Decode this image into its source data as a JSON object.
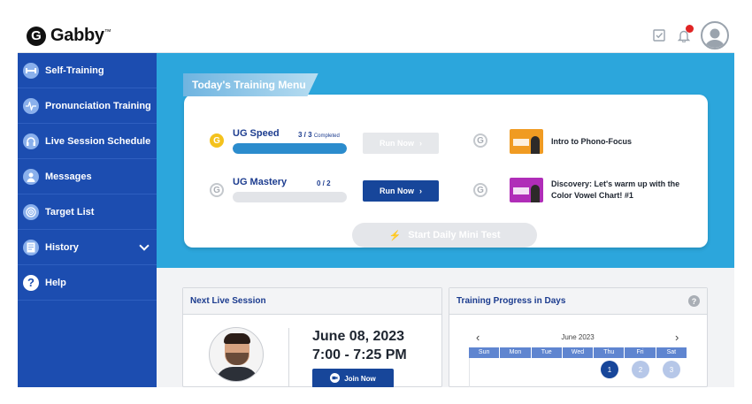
{
  "header": {
    "logo_text": "Gabby",
    "logo_tm": "™",
    "logo_mark": "G",
    "icons": [
      "check-square-icon",
      "bell-icon",
      "user-avatar-icon"
    ]
  },
  "sidebar": {
    "items": [
      {
        "label": "Self-Training",
        "icon": "dumbbell-icon"
      },
      {
        "label": "Pronunciation Training",
        "icon": "waveform-icon"
      },
      {
        "label": "Live Session Schedule",
        "icon": "headset-icon"
      },
      {
        "label": "Messages",
        "icon": "user-icon"
      },
      {
        "label": "Target List",
        "icon": "target-icon"
      },
      {
        "label": "History",
        "icon": "document-icon"
      },
      {
        "label": "Help",
        "icon": "question-icon"
      }
    ]
  },
  "training_menu": {
    "title": "Today's Training Menu",
    "tasks": [
      {
        "name": "UG Speed",
        "progress_text": "3 / 3",
        "completed_label": "Completed",
        "progress_fraction": 1.0,
        "button": "Run Now",
        "state": "completed"
      },
      {
        "name": "UG Mastery",
        "progress_text": "0 / 2",
        "completed_label": "",
        "progress_fraction": 0.0,
        "button": "Run Now",
        "state": "active"
      }
    ],
    "videos": [
      {
        "title": "Intro to Phono-Focus"
      },
      {
        "title": "Discovery: Let's warm up with the Color Vowel Chart! #1"
      }
    ],
    "mini_test_label": "Start Daily Mini Test"
  },
  "next_session": {
    "heading": "Next Live Session",
    "date": "June 08, 2023",
    "time": "7:00 - 7:25 PM",
    "join_label": "Join Now"
  },
  "progress_calendar": {
    "heading": "Training Progress in Days",
    "help_label": "?",
    "month": "June 2023",
    "prev": "‹",
    "next": "›",
    "weekdays": [
      "Sun",
      "Mon",
      "Tue",
      "Wed",
      "Thu",
      "Fri",
      "Sat"
    ],
    "visible_days": [
      {
        "day": "1",
        "status": "done"
      },
      {
        "day": "2",
        "status": "future"
      },
      {
        "day": "3",
        "status": "future"
      }
    ]
  },
  "colors": {
    "brand_blue": "#1c4db0",
    "accent_cyan": "#2ca6dc",
    "button_navy": "#17469a",
    "gold": "#f4c21d"
  }
}
